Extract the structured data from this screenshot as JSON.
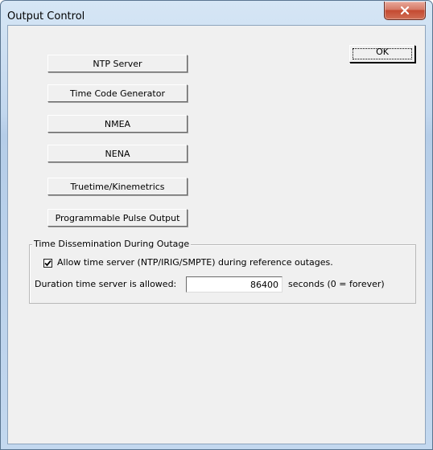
{
  "window": {
    "title": "Output Control"
  },
  "buttons": {
    "ok": "OK",
    "side": [
      "NTP Server",
      "Time Code Generator",
      "NMEA",
      "NENA",
      "Truetime/Kinemetrics",
      "Programmable Pulse Output"
    ]
  },
  "outage_group": {
    "legend": "Time Dissemination During Outage",
    "allow_checkbox_label": "Allow time server (NTP/IRIG/SMPTE) during reference outages.",
    "allow_checked": true,
    "duration_label": "Duration time server is allowed:",
    "duration_value": "86400",
    "duration_suffix": "seconds   (0 = forever)"
  },
  "icons": {
    "close": "close-icon",
    "check": "checkmark-icon"
  }
}
